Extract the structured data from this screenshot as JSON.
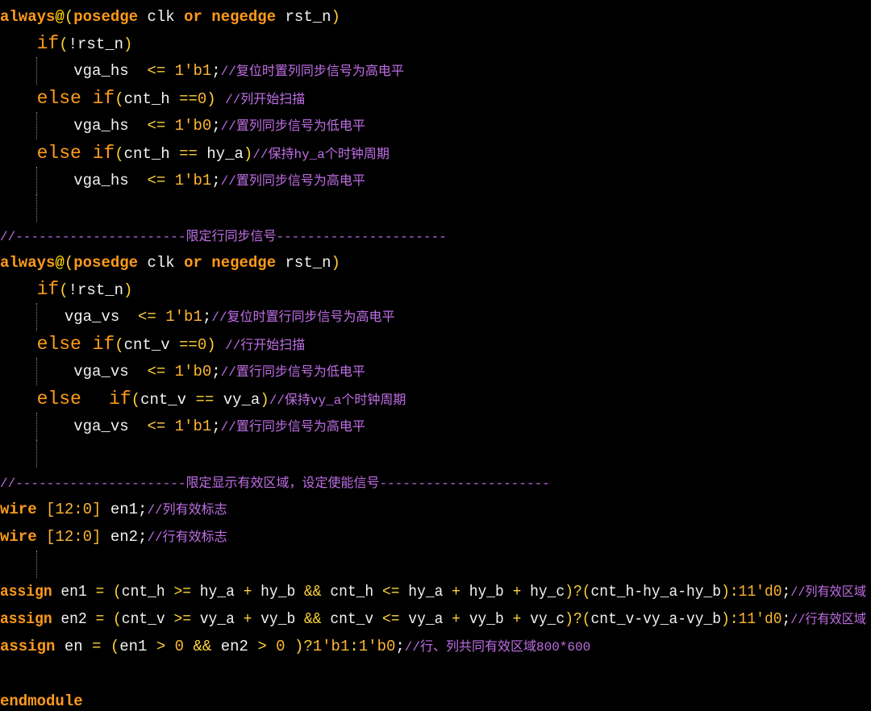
{
  "editor": {
    "theme": {
      "background": "#000000",
      "keyword": "#ff9a1a",
      "identifier": "#f2f2f2",
      "operator": "#ffd23a",
      "number": "#ffb530",
      "comment": "#c06ee6",
      "indent_guide": "#8a8a8a"
    },
    "lines": [
      {
        "guides": [],
        "tokens": [
          {
            "t": "kw",
            "v": "always"
          },
          {
            "t": "at",
            "v": "@"
          },
          {
            "t": "op",
            "v": "("
          },
          {
            "t": "kw",
            "v": "posedge"
          },
          {
            "t": "id",
            "v": " clk "
          },
          {
            "t": "kw",
            "v": "or"
          },
          {
            "t": "id",
            "v": " "
          },
          {
            "t": "kw",
            "v": "negedge"
          },
          {
            "t": "id",
            "v": " rst_n"
          },
          {
            "t": "op",
            "v": ")"
          }
        ]
      },
      {
        "guides": [],
        "tokens": [
          {
            "t": "id",
            "v": "    "
          },
          {
            "t": "ctl",
            "v": "if"
          },
          {
            "t": "op",
            "v": "("
          },
          {
            "t": "id",
            "v": "!rst_n"
          },
          {
            "t": "op",
            "v": ")"
          }
        ]
      },
      {
        "guides": [
          1
        ],
        "tokens": [
          {
            "t": "id",
            "v": "        vga_hs  "
          },
          {
            "t": "op",
            "v": "<= "
          },
          {
            "t": "num",
            "v": "1'b1"
          },
          {
            "t": "id",
            "v": ";"
          },
          {
            "t": "cm",
            "v": "//复位时置列同步信号为高电平"
          }
        ]
      },
      {
        "guides": [],
        "tokens": [
          {
            "t": "id",
            "v": "    "
          },
          {
            "t": "ctl",
            "v": "else if"
          },
          {
            "t": "op",
            "v": "("
          },
          {
            "t": "id",
            "v": "cnt_h "
          },
          {
            "t": "op",
            "v": "=="
          },
          {
            "t": "num",
            "v": "0"
          },
          {
            "t": "op",
            "v": ")"
          },
          {
            "t": "id",
            "v": " "
          },
          {
            "t": "cm",
            "v": "//列开始扫描"
          }
        ]
      },
      {
        "guides": [
          1
        ],
        "tokens": [
          {
            "t": "id",
            "v": "        vga_hs  "
          },
          {
            "t": "op",
            "v": "<= "
          },
          {
            "t": "num",
            "v": "1'b0"
          },
          {
            "t": "id",
            "v": ";"
          },
          {
            "t": "cm",
            "v": "//置列同步信号为低电平"
          }
        ]
      },
      {
        "guides": [],
        "tokens": [
          {
            "t": "id",
            "v": "    "
          },
          {
            "t": "ctl",
            "v": "else if"
          },
          {
            "t": "op",
            "v": "("
          },
          {
            "t": "id",
            "v": "cnt_h "
          },
          {
            "t": "op",
            "v": "=="
          },
          {
            "t": "id",
            "v": " hy_a"
          },
          {
            "t": "op",
            "v": ")"
          },
          {
            "t": "cm",
            "v": "//保持hy_a个时钟周期"
          }
        ]
      },
      {
        "guides": [
          1
        ],
        "tokens": [
          {
            "t": "id",
            "v": "        vga_hs  "
          },
          {
            "t": "op",
            "v": "<= "
          },
          {
            "t": "num",
            "v": "1'b1"
          },
          {
            "t": "id",
            "v": ";"
          },
          {
            "t": "cm",
            "v": "//置列同步信号为高电平"
          }
        ]
      },
      {
        "guides": [
          1
        ],
        "tokens": []
      },
      {
        "guides": [],
        "tokens": [
          {
            "t": "cm",
            "v": "//----------------------限定行同步信号----------------------"
          }
        ]
      },
      {
        "guides": [],
        "tokens": [
          {
            "t": "kw",
            "v": "always"
          },
          {
            "t": "at",
            "v": "@"
          },
          {
            "t": "op",
            "v": "("
          },
          {
            "t": "kw",
            "v": "posedge"
          },
          {
            "t": "id",
            "v": " clk "
          },
          {
            "t": "kw",
            "v": "or"
          },
          {
            "t": "id",
            "v": " "
          },
          {
            "t": "kw",
            "v": "negedge"
          },
          {
            "t": "id",
            "v": " rst_n"
          },
          {
            "t": "op",
            "v": ")"
          }
        ]
      },
      {
        "guides": [],
        "tokens": [
          {
            "t": "id",
            "v": "    "
          },
          {
            "t": "ctl",
            "v": "if"
          },
          {
            "t": "op",
            "v": "("
          },
          {
            "t": "id",
            "v": "!rst_n"
          },
          {
            "t": "op",
            "v": ")"
          }
        ]
      },
      {
        "guides": [
          1
        ],
        "tokens": [
          {
            "t": "id",
            "v": "       vga_vs  "
          },
          {
            "t": "op",
            "v": "<= "
          },
          {
            "t": "num",
            "v": "1'b1"
          },
          {
            "t": "id",
            "v": ";"
          },
          {
            "t": "cm",
            "v": "//复位时置行同步信号为高电平"
          }
        ]
      },
      {
        "guides": [],
        "tokens": [
          {
            "t": "id",
            "v": "    "
          },
          {
            "t": "ctl",
            "v": "else if"
          },
          {
            "t": "op",
            "v": "("
          },
          {
            "t": "id",
            "v": "cnt_v "
          },
          {
            "t": "op",
            "v": "=="
          },
          {
            "t": "num",
            "v": "0"
          },
          {
            "t": "op",
            "v": ")"
          },
          {
            "t": "id",
            "v": " "
          },
          {
            "t": "cm",
            "v": "//行开始扫描"
          }
        ]
      },
      {
        "guides": [
          1
        ],
        "tokens": [
          {
            "t": "id",
            "v": "        vga_vs  "
          },
          {
            "t": "op",
            "v": "<= "
          },
          {
            "t": "num",
            "v": "1'b0"
          },
          {
            "t": "id",
            "v": ";"
          },
          {
            "t": "cm",
            "v": "//置行同步信号为低电平"
          }
        ]
      },
      {
        "guides": [],
        "tokens": [
          {
            "t": "id",
            "v": "    "
          },
          {
            "t": "ctl",
            "v": "else"
          },
          {
            "t": "id",
            "v": "   "
          },
          {
            "t": "ctl",
            "v": "if"
          },
          {
            "t": "op",
            "v": "("
          },
          {
            "t": "id",
            "v": "cnt_v "
          },
          {
            "t": "op",
            "v": "=="
          },
          {
            "t": "id",
            "v": " vy_a"
          },
          {
            "t": "op",
            "v": ")"
          },
          {
            "t": "cm",
            "v": "//保持vy_a个时钟周期"
          }
        ]
      },
      {
        "guides": [
          1
        ],
        "tokens": [
          {
            "t": "id",
            "v": "        vga_vs  "
          },
          {
            "t": "op",
            "v": "<= "
          },
          {
            "t": "num",
            "v": "1'b1"
          },
          {
            "t": "id",
            "v": ";"
          },
          {
            "t": "cm",
            "v": "//置行同步信号为高电平"
          }
        ]
      },
      {
        "guides": [
          1
        ],
        "tokens": []
      },
      {
        "guides": [],
        "tokens": [
          {
            "t": "cm",
            "v": "//----------------------限定显示有效区域，设定使能信号----------------------"
          }
        ]
      },
      {
        "guides": [],
        "tokens": [
          {
            "t": "kw",
            "v": "wire"
          },
          {
            "t": "id",
            "v": " "
          },
          {
            "t": "num",
            "v": "[12:0]"
          },
          {
            "t": "id",
            "v": " en1;"
          },
          {
            "t": "cm",
            "v": "//列有效标志"
          }
        ]
      },
      {
        "guides": [],
        "tokens": [
          {
            "t": "kw",
            "v": "wire"
          },
          {
            "t": "id",
            "v": " "
          },
          {
            "t": "num",
            "v": "[12:0]"
          },
          {
            "t": "id",
            "v": " en2;"
          },
          {
            "t": "cm",
            "v": "//行有效标志"
          }
        ]
      },
      {
        "guides": [
          0
        ],
        "tokens": []
      },
      {
        "guides": [],
        "tokens": [
          {
            "t": "kw",
            "v": "assign"
          },
          {
            "t": "id",
            "v": " en1 "
          },
          {
            "t": "op",
            "v": "="
          },
          {
            "t": "id",
            "v": " "
          },
          {
            "t": "op",
            "v": "("
          },
          {
            "t": "id",
            "v": "cnt_h "
          },
          {
            "t": "op",
            "v": ">="
          },
          {
            "t": "id",
            "v": " hy_a "
          },
          {
            "t": "op",
            "v": "+"
          },
          {
            "t": "id",
            "v": " hy_b "
          },
          {
            "t": "op",
            "v": "&&"
          },
          {
            "t": "id",
            "v": " cnt_h "
          },
          {
            "t": "op",
            "v": "<="
          },
          {
            "t": "id",
            "v": " hy_a "
          },
          {
            "t": "op",
            "v": "+"
          },
          {
            "t": "id",
            "v": " hy_b "
          },
          {
            "t": "op",
            "v": "+"
          },
          {
            "t": "id",
            "v": " hy_c"
          },
          {
            "t": "op",
            "v": ")?("
          },
          {
            "t": "id",
            "v": "cnt_h-hy_a-hy_b"
          },
          {
            "t": "op",
            "v": "):"
          },
          {
            "t": "num",
            "v": "11'd0"
          },
          {
            "t": "id",
            "v": ";"
          },
          {
            "t": "cm",
            "v": "//列有效区域"
          }
        ]
      },
      {
        "guides": [],
        "tokens": [
          {
            "t": "kw",
            "v": "assign"
          },
          {
            "t": "id",
            "v": " en2 "
          },
          {
            "t": "op",
            "v": "="
          },
          {
            "t": "id",
            "v": " "
          },
          {
            "t": "op",
            "v": "("
          },
          {
            "t": "id",
            "v": "cnt_v "
          },
          {
            "t": "op",
            "v": ">="
          },
          {
            "t": "id",
            "v": " vy_a "
          },
          {
            "t": "op",
            "v": "+"
          },
          {
            "t": "id",
            "v": " vy_b "
          },
          {
            "t": "op",
            "v": "&&"
          },
          {
            "t": "id",
            "v": " cnt_v "
          },
          {
            "t": "op",
            "v": "<="
          },
          {
            "t": "id",
            "v": " vy_a "
          },
          {
            "t": "op",
            "v": "+"
          },
          {
            "t": "id",
            "v": " vy_b "
          },
          {
            "t": "op",
            "v": "+"
          },
          {
            "t": "id",
            "v": " vy_c"
          },
          {
            "t": "op",
            "v": ")?("
          },
          {
            "t": "id",
            "v": "cnt_v-vy_a-vy_b"
          },
          {
            "t": "op",
            "v": "):"
          },
          {
            "t": "num",
            "v": "11'd0"
          },
          {
            "t": "id",
            "v": ";"
          },
          {
            "t": "cm",
            "v": "//行有效区域"
          }
        ]
      },
      {
        "guides": [],
        "tokens": [
          {
            "t": "kw",
            "v": "assign"
          },
          {
            "t": "id",
            "v": " en "
          },
          {
            "t": "op",
            "v": "="
          },
          {
            "t": "id",
            "v": " "
          },
          {
            "t": "op",
            "v": "("
          },
          {
            "t": "id",
            "v": "en1 "
          },
          {
            "t": "op",
            "v": ">"
          },
          {
            "t": "num",
            "v": " 0 "
          },
          {
            "t": "op",
            "v": "&&"
          },
          {
            "t": "id",
            "v": " en2 "
          },
          {
            "t": "op",
            "v": ">"
          },
          {
            "t": "num",
            "v": " 0 "
          },
          {
            "t": "op",
            "v": ")?"
          },
          {
            "t": "num",
            "v": "1'b1"
          },
          {
            "t": "op",
            "v": ":"
          },
          {
            "t": "num",
            "v": "1'b0"
          },
          {
            "t": "id",
            "v": ";"
          },
          {
            "t": "cm",
            "v": "//行、列共同有效区域800*600"
          }
        ]
      },
      {
        "guides": [],
        "tokens": []
      },
      {
        "guides": [],
        "tokens": [
          {
            "t": "kw",
            "v": "endmodule"
          }
        ]
      }
    ]
  }
}
